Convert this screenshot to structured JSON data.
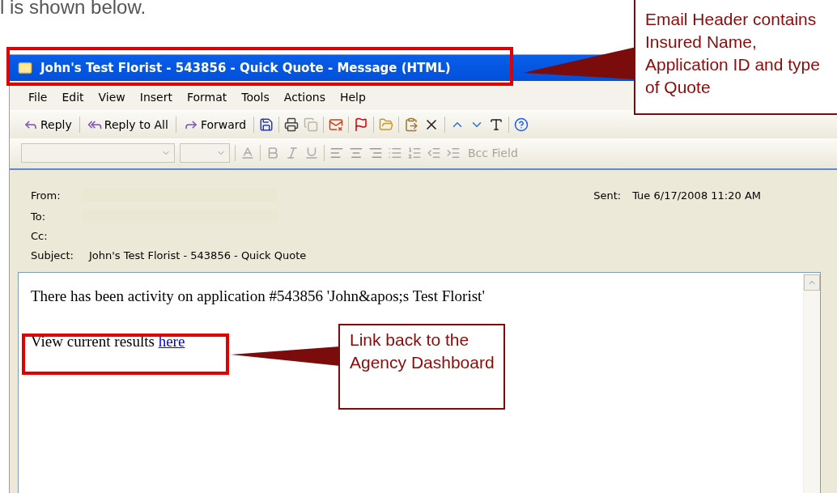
{
  "intro_text": "l is shown below.",
  "window": {
    "title": "John's Test Florist - 543856 - Quick Quote - Message (HTML)",
    "title_highlighted": true
  },
  "menu": [
    "File",
    "Edit",
    "View",
    "Insert",
    "Format",
    "Tools",
    "Actions",
    "Help"
  ],
  "reply_buttons": [
    {
      "kind": "reply",
      "label": "Reply"
    },
    {
      "kind": "reply_all",
      "label": "Reply to All"
    },
    {
      "kind": "forward",
      "label": "Forward"
    }
  ],
  "format_toolbar": {
    "bcc_label": "Bcc Field",
    "disabled": true
  },
  "header": {
    "fields": [
      {
        "label": "From:",
        "redacted": true
      },
      {
        "label": "To:",
        "redacted": true
      },
      {
        "label": "Cc:"
      },
      {
        "label": "Subject:",
        "value": "John's Test Florist - 543856 - Quick Quote"
      }
    ],
    "sent_label": "Sent:",
    "sent_value": "Tue 6/17/2008 11:20 AM"
  },
  "body": {
    "paragraph": "There has been activity on application #543856 'John&apos;s Test Florist'",
    "link_intro": "View current results",
    "link": "here",
    "link_highlighted": true
  },
  "callouts": [
    {
      "text": "Email Header contains Insured Name, Application ID and type of Quote"
    },
    {
      "text": "Link back to the Agency Dashboard"
    }
  ]
}
